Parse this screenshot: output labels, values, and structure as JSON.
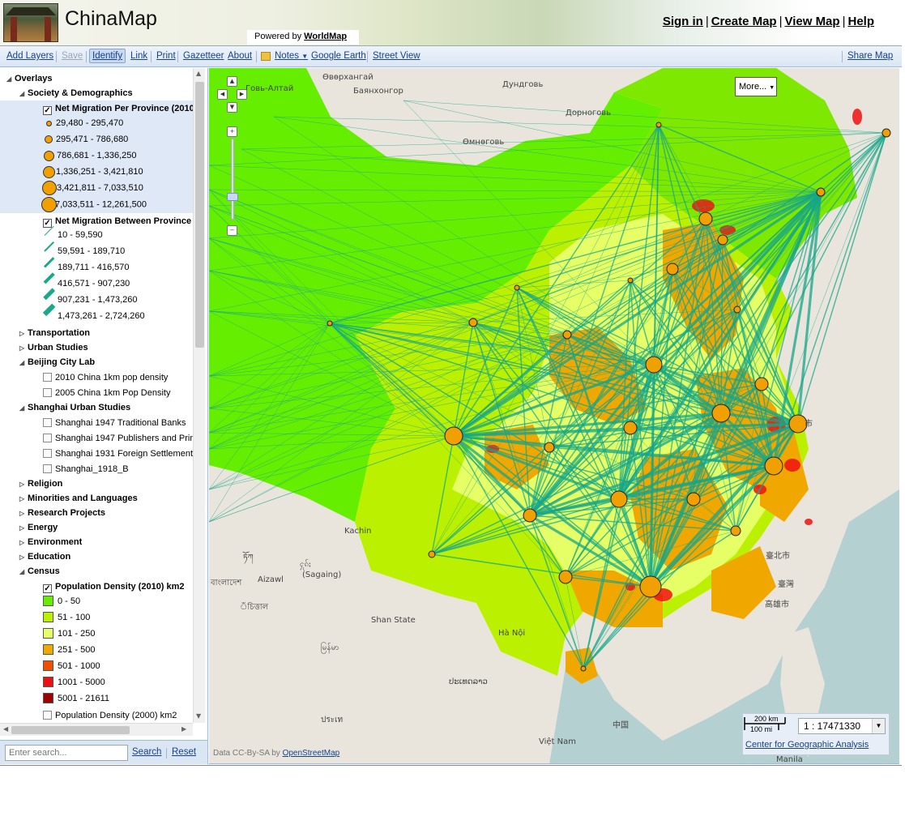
{
  "header": {
    "title": "ChinaMap",
    "powered_by_prefix": "Powered by",
    "powered_by_link": "WorldMap",
    "links": [
      "Sign in",
      "Create Map",
      "View Map",
      "Help"
    ]
  },
  "toolbar": {
    "add_layers": "Add Layers",
    "save": "Save",
    "identify": "Identify",
    "link": "Link",
    "print": "Print",
    "gazetteer": "Gazetteer",
    "about": "About",
    "notes": "Notes",
    "google_earth": "Google Earth",
    "street_view": "Street View",
    "share_map": "Share Map"
  },
  "sidebar": {
    "overlays": "Overlays",
    "groups": {
      "society": "Society & Demographics",
      "transportation": "Transportation",
      "urban_studies": "Urban Studies",
      "beijing": "Beijing City Lab",
      "shanghai": "Shanghai Urban Studies",
      "religion": "Religion",
      "minorities": "Minorities and Languages",
      "research": "Research Projects",
      "energy": "Energy",
      "environment": "Environment",
      "education": "Education",
      "census": "Census"
    },
    "layers": {
      "net_migration_province": "Net Migration Per Province (2010",
      "net_migration_between": "Net Migration Between Province",
      "beijing_2010": "2010 China 1km pop density",
      "beijing_2005": "2005 China 1km Pop Density",
      "sh_banks": "Shanghai 1947 Traditional Banks",
      "sh_publishers": "Shanghai 1947 Publishers and Prin",
      "sh_foreign": "Shanghai 1931 Foreign Settlements",
      "sh_1918": "Shanghai_1918_B",
      "pop_density_2010": "Population Density (2010) km2",
      "pop_density_2000": "Population Density (2000) km2"
    },
    "legend_province": [
      "29,480 - 295,470",
      "295,471 - 786,680",
      "786,681 - 1,336,250",
      "1,336,251 - 3,421,810",
      "3,421,811 - 7,033,510",
      "7,033,511 - 12,261,500"
    ],
    "legend_between": [
      "10 - 59,590",
      "59,591 - 189,710",
      "189,711 - 416,570",
      "416,571 - 907,230",
      "907,231 - 1,473,260",
      "1,473,261 - 2,724,260"
    ],
    "legend_density": [
      "0 - 50",
      "51 - 100",
      "101 - 250",
      "251 - 500",
      "501 - 1000",
      "1001 - 5000",
      "5001 - 21611"
    ],
    "density_colors": [
      "#66ee00",
      "#bbf000",
      "#e6ff66",
      "#f0a800",
      "#f05000",
      "#ee1010",
      "#a00000"
    ],
    "search_placeholder": "Enter search...",
    "search": "Search",
    "reset": "Reset"
  },
  "map": {
    "more": "More...",
    "attribution_prefix": "Data CC-By-SA by",
    "attribution_link": "OpenStreetMap",
    "scale_km": "200 km",
    "scale_mi": "100 mi",
    "scale_value": "1 : 17471330",
    "cga_link": "Center for Geographic Analysis",
    "labels": {
      "govi_altai": "Говь-Алтай",
      "uvurkhangai": "Өвөрхангай",
      "dundgovi": "Дундговь",
      "bayankhongor": "Баянхонгор",
      "dornogovi": "Дорноговь",
      "umnugovi": "Өмнөговь",
      "kachin": "Kachin",
      "sagaing": "(Sagaing)",
      "aizawl": "Aizawl",
      "shan_state": "Shan State",
      "ha_noi": "Hà Nội",
      "laos": "ປະເທດລາວ",
      "zhongguo": "中国",
      "viet_nam": "Việt Nam",
      "manila": "Manila",
      "taipei": "臺北市",
      "taiwan": "臺灣",
      "kaohsiung": "高雄市",
      "assam": "সসম",
      "bangladesh": "বাংলাদেশ",
      "myanmar": "မြန်မာ",
      "city_shi": "市",
      "fragment_1": "ঁচিত্তাল",
      "fragment_2": "ཏོཀ",
      "fragment_3": "ႁုၵ်ႈ",
      "fragment_4": "ประเท"
    }
  }
}
